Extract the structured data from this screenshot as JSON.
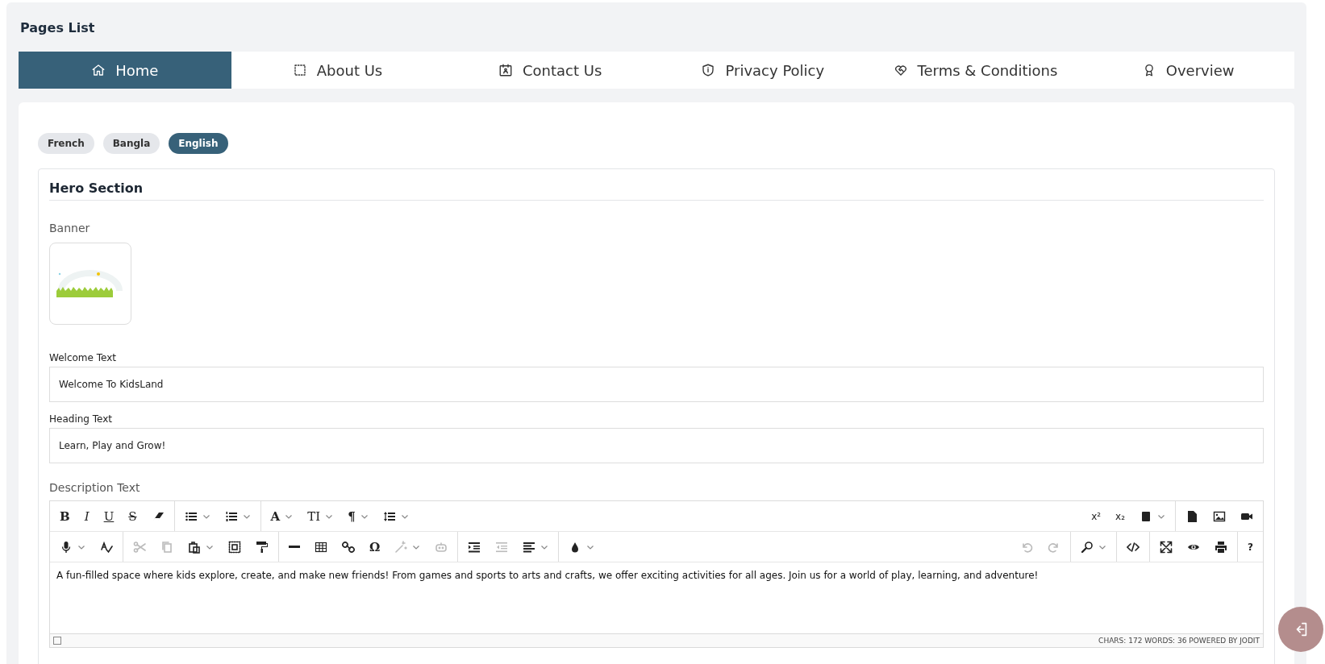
{
  "page_title": "Pages List",
  "tabs": [
    {
      "label": "Home",
      "selected": true
    },
    {
      "label": "About Us",
      "selected": false
    },
    {
      "label": "Contact Us",
      "selected": false
    },
    {
      "label": "Privacy Policy",
      "selected": false
    },
    {
      "label": "Terms & Conditions",
      "selected": false
    },
    {
      "label": "Overview",
      "selected": false
    }
  ],
  "languages": [
    {
      "label": "French",
      "selected": false
    },
    {
      "label": "Bangla",
      "selected": false
    },
    {
      "label": "English",
      "selected": true
    }
  ],
  "section": {
    "title": "Hero Section",
    "banner_label": "Banner",
    "fields": [
      {
        "label": "Welcome Text",
        "value": "Welcome To KidsLand"
      },
      {
        "label": "Heading Text",
        "value": "Learn, Play and Grow!"
      }
    ],
    "description_label": "Description Text",
    "editor": {
      "toolbar_rows": [
        {
          "left": [
            [
              {
                "kind": "bold",
                "label": "B",
                "dropdown": false,
                "disabled": false
              },
              {
                "kind": "italic",
                "label": "I",
                "dropdown": false,
                "disabled": false
              },
              {
                "kind": "underline",
                "label": "U",
                "dropdown": false,
                "disabled": false
              },
              {
                "kind": "strike",
                "label": "S",
                "dropdown": false,
                "disabled": false
              },
              {
                "kind": "eraser",
                "dropdown": false,
                "disabled": false
              }
            ],
            [
              {
                "kind": "bullets",
                "dropdown": true,
                "disabled": false
              },
              {
                "kind": "numbers",
                "dropdown": true,
                "disabled": false
              }
            ],
            [
              {
                "kind": "font",
                "label": "A",
                "dropdown": true,
                "disabled": false
              },
              {
                "kind": "size",
                "label": "TI",
                "dropdown": true,
                "disabled": false
              },
              {
                "kind": "para",
                "label": "¶",
                "dropdown": true,
                "disabled": false
              },
              {
                "kind": "lineheight",
                "dropdown": true,
                "disabled": false
              }
            ]
          ],
          "right": [
            [
              {
                "kind": "sup",
                "label": "x²",
                "dropdown": false,
                "disabled": false
              },
              {
                "kind": "sub",
                "label": "x₂",
                "dropdown": false,
                "disabled": false
              },
              {
                "kind": "book",
                "dropdown": true,
                "disabled": false
              }
            ],
            [
              {
                "kind": "file",
                "dropdown": false,
                "disabled": false
              },
              {
                "kind": "image",
                "dropdown": false,
                "disabled": false
              },
              {
                "kind": "video",
                "dropdown": false,
                "disabled": false
              }
            ]
          ]
        },
        {
          "left": [
            [
              {
                "kind": "mic",
                "dropdown": true,
                "disabled": false
              },
              {
                "kind": "spell",
                "dropdown": false,
                "disabled": false
              }
            ],
            [
              {
                "kind": "cut",
                "dropdown": false,
                "disabled": true
              },
              {
                "kind": "copy",
                "dropdown": false,
                "disabled": true
              },
              {
                "kind": "paste",
                "dropdown": true,
                "disabled": false
              },
              {
                "kind": "selectall",
                "dropdown": false,
                "disabled": false
              },
              {
                "kind": "brush",
                "dropdown": false,
                "disabled": false
              }
            ],
            [
              {
                "kind": "hr",
                "dropdown": false,
                "disabled": false
              },
              {
                "kind": "table",
                "dropdown": false,
                "disabled": false
              },
              {
                "kind": "link",
                "dropdown": false,
                "disabled": false
              },
              {
                "kind": "symbol",
                "label": "Ω",
                "dropdown": false,
                "disabled": false
              },
              {
                "kind": "magic",
                "dropdown": true,
                "disabled": true
              },
              {
                "kind": "robot",
                "dropdown": false,
                "disabled": true
              }
            ],
            [
              {
                "kind": "indent",
                "dropdown": false,
                "disabled": false
              },
              {
                "kind": "outdent",
                "dropdown": false,
                "disabled": true
              },
              {
                "kind": "align",
                "dropdown": true,
                "disabled": false
              }
            ],
            [
              {
                "kind": "color",
                "dropdown": true,
                "disabled": false
              }
            ]
          ],
          "right": [
            [
              {
                "kind": "undo",
                "dropdown": false,
                "disabled": true
              },
              {
                "kind": "redo",
                "dropdown": false,
                "disabled": true
              }
            ],
            [
              {
                "kind": "find",
                "dropdown": true,
                "disabled": false
              }
            ],
            [
              {
                "kind": "source",
                "dropdown": false,
                "disabled": false
              }
            ],
            [
              {
                "kind": "fullsize",
                "dropdown": false,
                "disabled": false
              },
              {
                "kind": "preview",
                "dropdown": false,
                "disabled": false
              },
              {
                "kind": "print",
                "dropdown": false,
                "disabled": false
              }
            ],
            [
              {
                "kind": "help",
                "label": "?",
                "dropdown": false,
                "disabled": false
              }
            ]
          ]
        }
      ],
      "content": "A fun-filled space where kids explore, create, and make new friends! From games and sports to arts and crafts, we offer exciting activities for all ages. Join us for a world of play, learning, and adventure!",
      "status": [
        "CHARS: 172",
        "WORDS: 36",
        "POWERED BY JODIT"
      ]
    }
  }
}
